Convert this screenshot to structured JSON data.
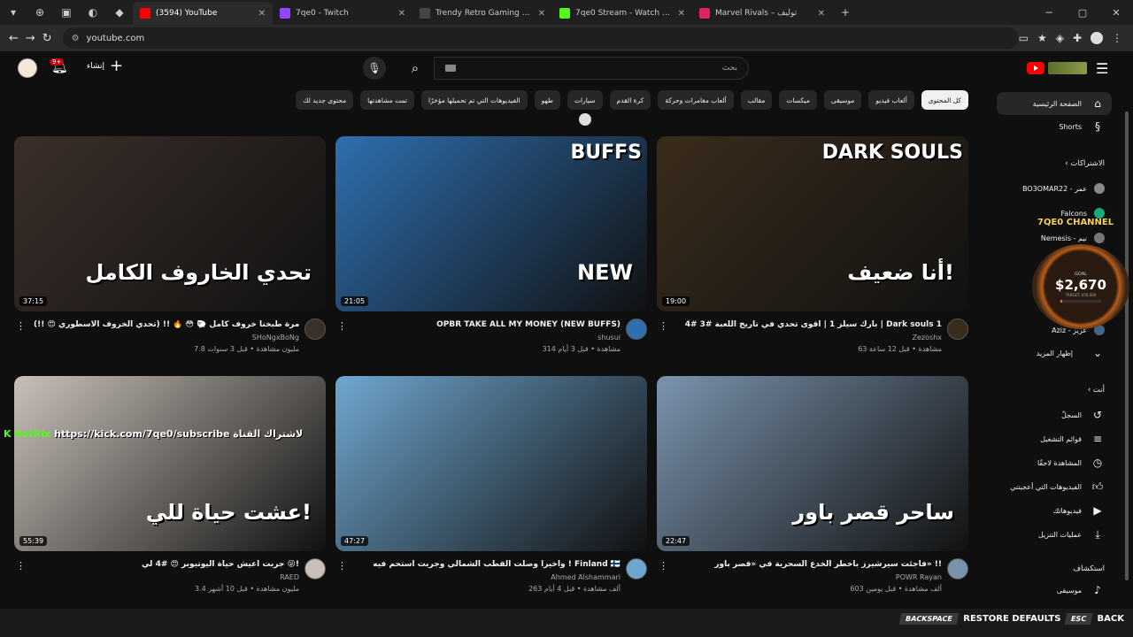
{
  "browser": {
    "tabs": [
      {
        "label": "(3594) YouTube",
        "favicon_color": "#ff0000",
        "active": true
      },
      {
        "label": "7qe0 - Twitch",
        "favicon_color": "#9146ff",
        "active": false
      },
      {
        "label": "Trendy Retro Gaming & Cult Fil",
        "favicon_color": "#444444",
        "active": false
      },
      {
        "label": "7qe0 Stream - Watch Live on Ki",
        "favicon_color": "#53fc18",
        "active": false
      },
      {
        "label": "Marvel Rivals – توليف",
        "favicon_color": "#e0245e",
        "active": false
      }
    ],
    "url": "youtube.com"
  },
  "header": {
    "notification_count": "9+",
    "create_label": "إنشاء",
    "search_placeholder": "بحث"
  },
  "chips": [
    {
      "label": "كل المحتوى",
      "active": true
    },
    {
      "label": "ألعاب فيديو",
      "active": false
    },
    {
      "label": "موسيقى",
      "active": false
    },
    {
      "label": "ميكسات",
      "active": false
    },
    {
      "label": "مقالب",
      "active": false
    },
    {
      "label": "ألعاب مغامرات وحركة",
      "active": false
    },
    {
      "label": "كرة القدم",
      "active": false
    },
    {
      "label": "سيارات",
      "active": false
    },
    {
      "label": "طهو",
      "active": false
    },
    {
      "label": "الفيديوهات التي تم تحميلها مؤخرًا",
      "active": false
    },
    {
      "label": "تمت مشاهدتها",
      "active": false
    },
    {
      "label": "محتوى جديد لك",
      "active": false
    }
  ],
  "videos": [
    {
      "duration": "19:00",
      "title": "بارك سيلز 1 | أقوى تحدي في تاريخ اللعبة #3 #4 | Dark souls 1",
      "channel": "Zezoshx",
      "stats": "63 مشاهدة • قبل 12 ساعة",
      "thumb_color": "#3a2c1c",
      "overlay": "أنا ضعيف!",
      "overlay2": "DARK SOULS"
    },
    {
      "duration": "21:05",
      "title": "OPBR TAKE ALL MY MONEY (NEW BUFFS)",
      "channel": "shusui",
      "stats": "314 مشاهدة • قبل 3 أيام",
      "thumb_color": "#2f6fb0",
      "overlay": "NEW",
      "overlay2": "BUFFS"
    },
    {
      "duration": "37:15",
      "title": "لأول مرة طبخنا خروف كامل 🐑 😳 🔥 !! (تحدي الخروف الاسطوري 😍 !!)",
      "channel": "SHoNgxBoNg",
      "stats": "7.8 مليون مشاهدة • قبل 3 سنوات",
      "thumb_color": "#3b2f2a",
      "overlay": "تحدي الخاروف الكامل",
      "overlay2": ""
    },
    {
      "duration": "22:47",
      "title": "فاجئت سيرشيرز بأخطر الخدع السحرية في «قصر باور» !!",
      "channel": "POWR Rayan",
      "stats": "603 ألف مشاهدة • قبل يومين",
      "thumb_color": "#7a93ad",
      "overlay": "ساحر قصر باور",
      "overlay2": ""
    },
    {
      "duration": "47:27",
      "title": "واخيرا وصلت القطب الشمالي وجربت استحم فيه ! Finland 🇫🇮",
      "channel": "Ahmed Alshammari",
      "stats": "263 ألف مشاهدة • قبل 4 أيام",
      "thumb_color": "#6fa6cf",
      "overlay": "",
      "overlay2": ""
    },
    {
      "duration": "55:39",
      "title": "جربت أعيش حياة اليوتيوبر 😍 #4 لي 😜!",
      "channel": "RAED",
      "stats": "3.4 مليون مشاهدة • قبل 10 أشهر",
      "thumb_color": "#c8c0b8",
      "overlay": "عشت حياة للي!",
      "overlay2": ""
    }
  ],
  "sidebar": {
    "home": "الصفحة الرئيسية",
    "shorts": "Shorts",
    "subscriptions_header": "الاشتراكات",
    "subscriptions": [
      {
        "label": "BO3OMAR22 - عمر",
        "color": "#888888"
      },
      {
        "label": "Falcons",
        "color": "#1aaa7a"
      },
      {
        "label": "Nemesis - نيم",
        "color": "#777777"
      },
      {
        "label": "Aziz - عزيز",
        "color": "#446688"
      }
    ],
    "show_more": "إظهار المزيد",
    "you_header": "أنت",
    "you_items": [
      {
        "label": "السجلّ",
        "icon": "history-icon"
      },
      {
        "label": "قوائم التشغيل",
        "icon": "playlist-icon"
      },
      {
        "label": "المشاهدة لاحقًا",
        "icon": "clock-icon"
      },
      {
        "label": "الفيديوهات التي أعجبتني",
        "icon": "thumb-up-icon"
      },
      {
        "label": "فيديوهاتك",
        "icon": "video-icon"
      },
      {
        "label": "عمليات التنزيل",
        "icon": "download-icon"
      }
    ],
    "explore_header": "استكشاف",
    "explore_items": [
      {
        "label": "موسيقى",
        "icon": "music-icon"
      }
    ]
  },
  "overlay": {
    "channel_brand": "7QE0 CHANNEL",
    "goal_label": "GOAL",
    "goal_amount": "$2,670",
    "goal_target": "TARGET: $50,000",
    "goal_progress": 0.053,
    "chat": [
      {
        "user": "BotRix",
        "message": "https://kick.com/7qe0/subscribe لاشتراك القناة"
      }
    ],
    "keys": [
      {
        "key": "BACKSPACE",
        "label": "RESTORE DEFAULTS"
      },
      {
        "key": "ESC",
        "label": "BACK"
      }
    ]
  }
}
